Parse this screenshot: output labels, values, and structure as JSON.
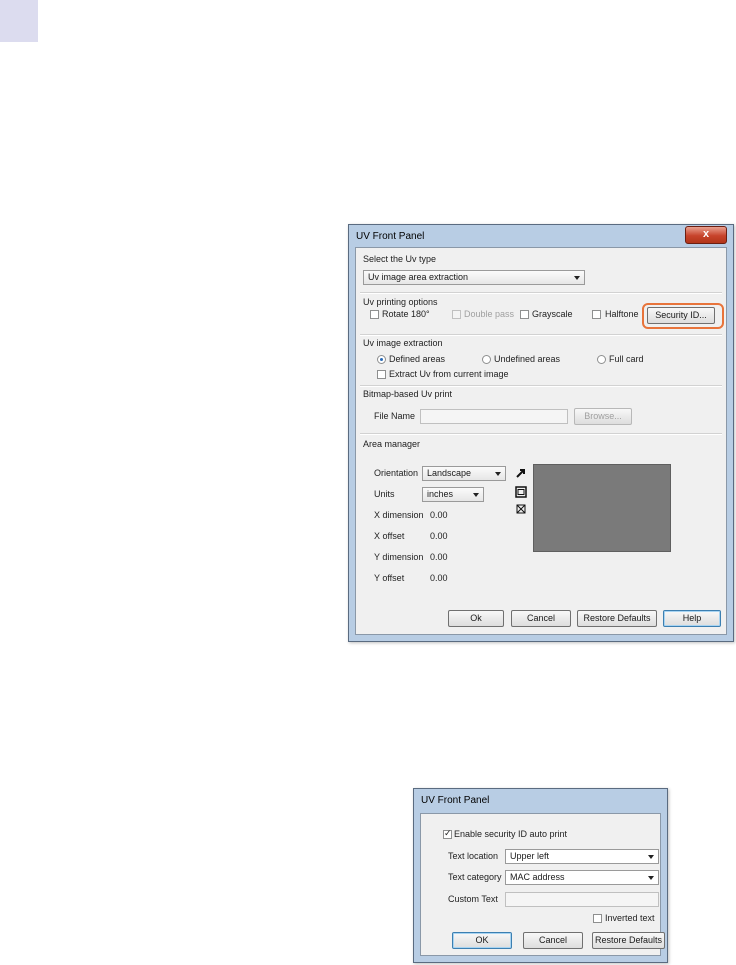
{
  "colors": {
    "highlight": "#e8743b",
    "preview": "#7a7a7a",
    "frame": "#b8cde4"
  },
  "uv_front_panel": {
    "title": "UV Front Panel",
    "close_label": "x",
    "uv_type": {
      "label": "Select the Uv type",
      "value": "Uv image area extraction"
    },
    "printing_options": {
      "label": "Uv printing options",
      "rotate": "Rotate 180°",
      "double_pass": "Double pass",
      "grayscale": "Grayscale",
      "halftone": "Halftone",
      "security_button": "Security ID..."
    },
    "image_extraction": {
      "label": "Uv image extraction",
      "defined": "Defined areas",
      "undefined": "Undefined areas",
      "full_card": "Full card",
      "extract_current": "Extract Uv from current image"
    },
    "bitmap": {
      "label": "Bitmap-based Uv print",
      "file_name_label": "File Name",
      "browse": "Browse..."
    },
    "area_manager": {
      "label": "Area manager",
      "orientation_label": "Orientation",
      "orientation_value": "Landscape",
      "units_label": "Units",
      "units_value": "inches",
      "x_dimension_label": "X dimension",
      "x_dimension_value": "0.00",
      "x_offset_label": "X offset",
      "x_offset_value": "0.00",
      "y_dimension_label": "Y dimension",
      "y_dimension_value": "0.00",
      "y_offset_label": "Y offset",
      "y_offset_value": "0.00"
    },
    "buttons": {
      "ok": "Ok",
      "cancel": "Cancel",
      "restore": "Restore Defaults",
      "help": "Help"
    }
  },
  "security_dialog": {
    "title": "UV Front Panel",
    "enable_label": "Enable security ID auto print",
    "text_location_label": "Text location",
    "text_location_value": "Upper left",
    "text_category_label": "Text category",
    "text_category_value": "MAC address",
    "custom_text_label": "Custom Text",
    "inverted_label": "Inverted text",
    "buttons": {
      "ok": "OK",
      "cancel": "Cancel",
      "restore": "Restore Defaults"
    }
  }
}
